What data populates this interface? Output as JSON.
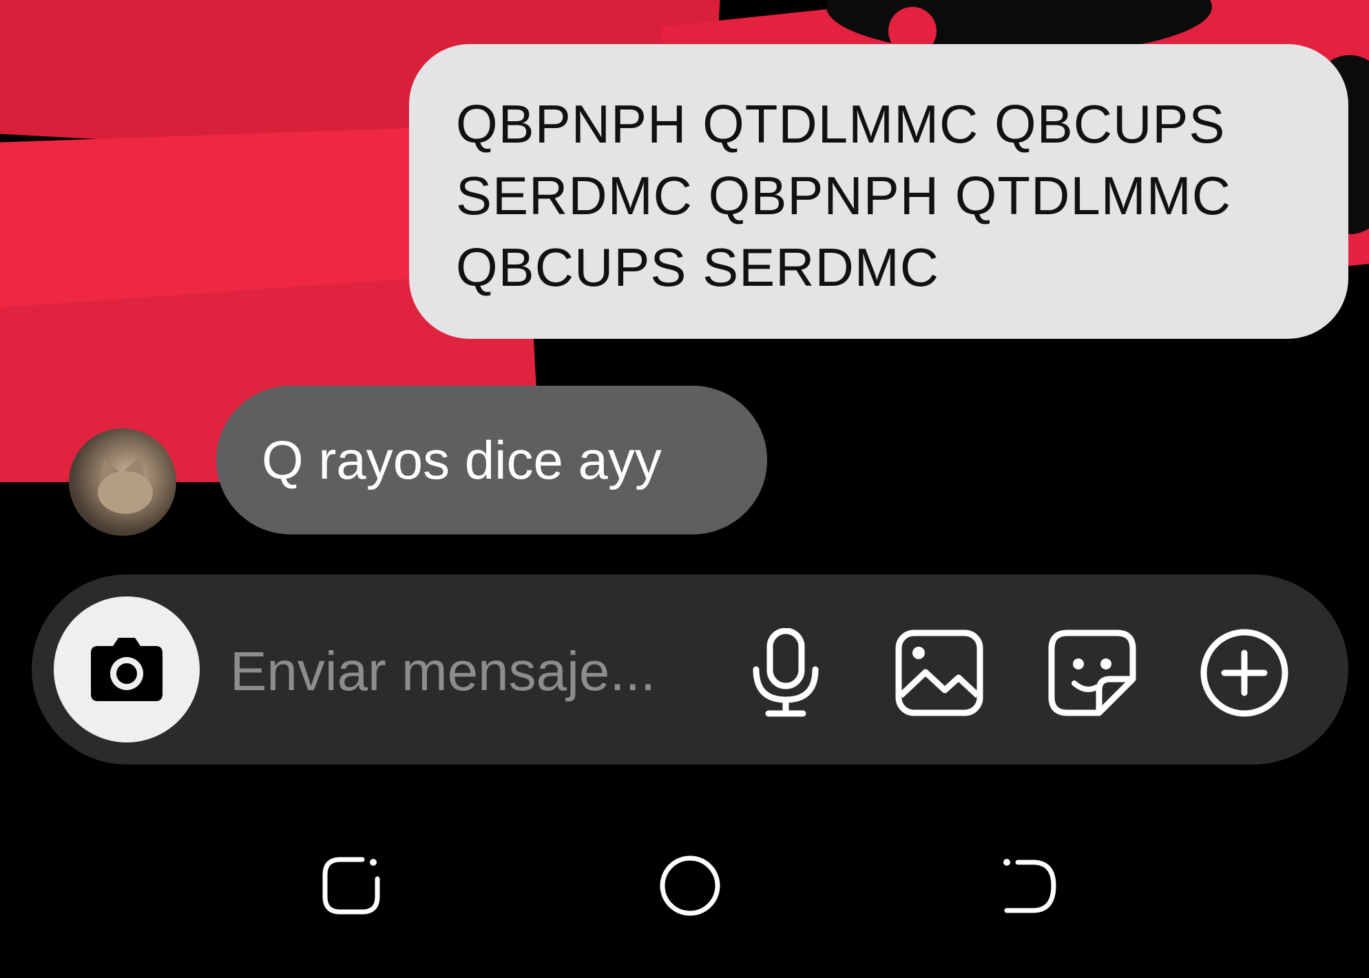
{
  "chat": {
    "messages": [
      {
        "direction": "outgoing",
        "lines": [
          "QBPNPH QTDLMMC QBCUPS",
          "SERDMC QBPNPH QTDLMMC",
          "QBCUPS SERDMC"
        ]
      },
      {
        "direction": "incoming",
        "text": "Q rayos dice ayy"
      }
    ]
  },
  "composer": {
    "placeholder": "Enviar mensaje...",
    "icons": [
      "camera-icon",
      "microphone-icon",
      "gallery-icon",
      "sticker-icon",
      "plus-icon"
    ]
  },
  "navigation_bar": {
    "icons": [
      "recent-apps-icon",
      "home-icon",
      "back-icon"
    ]
  },
  "colors": {
    "outgoing_bubble": "#e4e4e6",
    "incoming_bubble": "#5f5f61",
    "composer_bg": "#2b2b2d",
    "background_red": "#e4213f"
  }
}
